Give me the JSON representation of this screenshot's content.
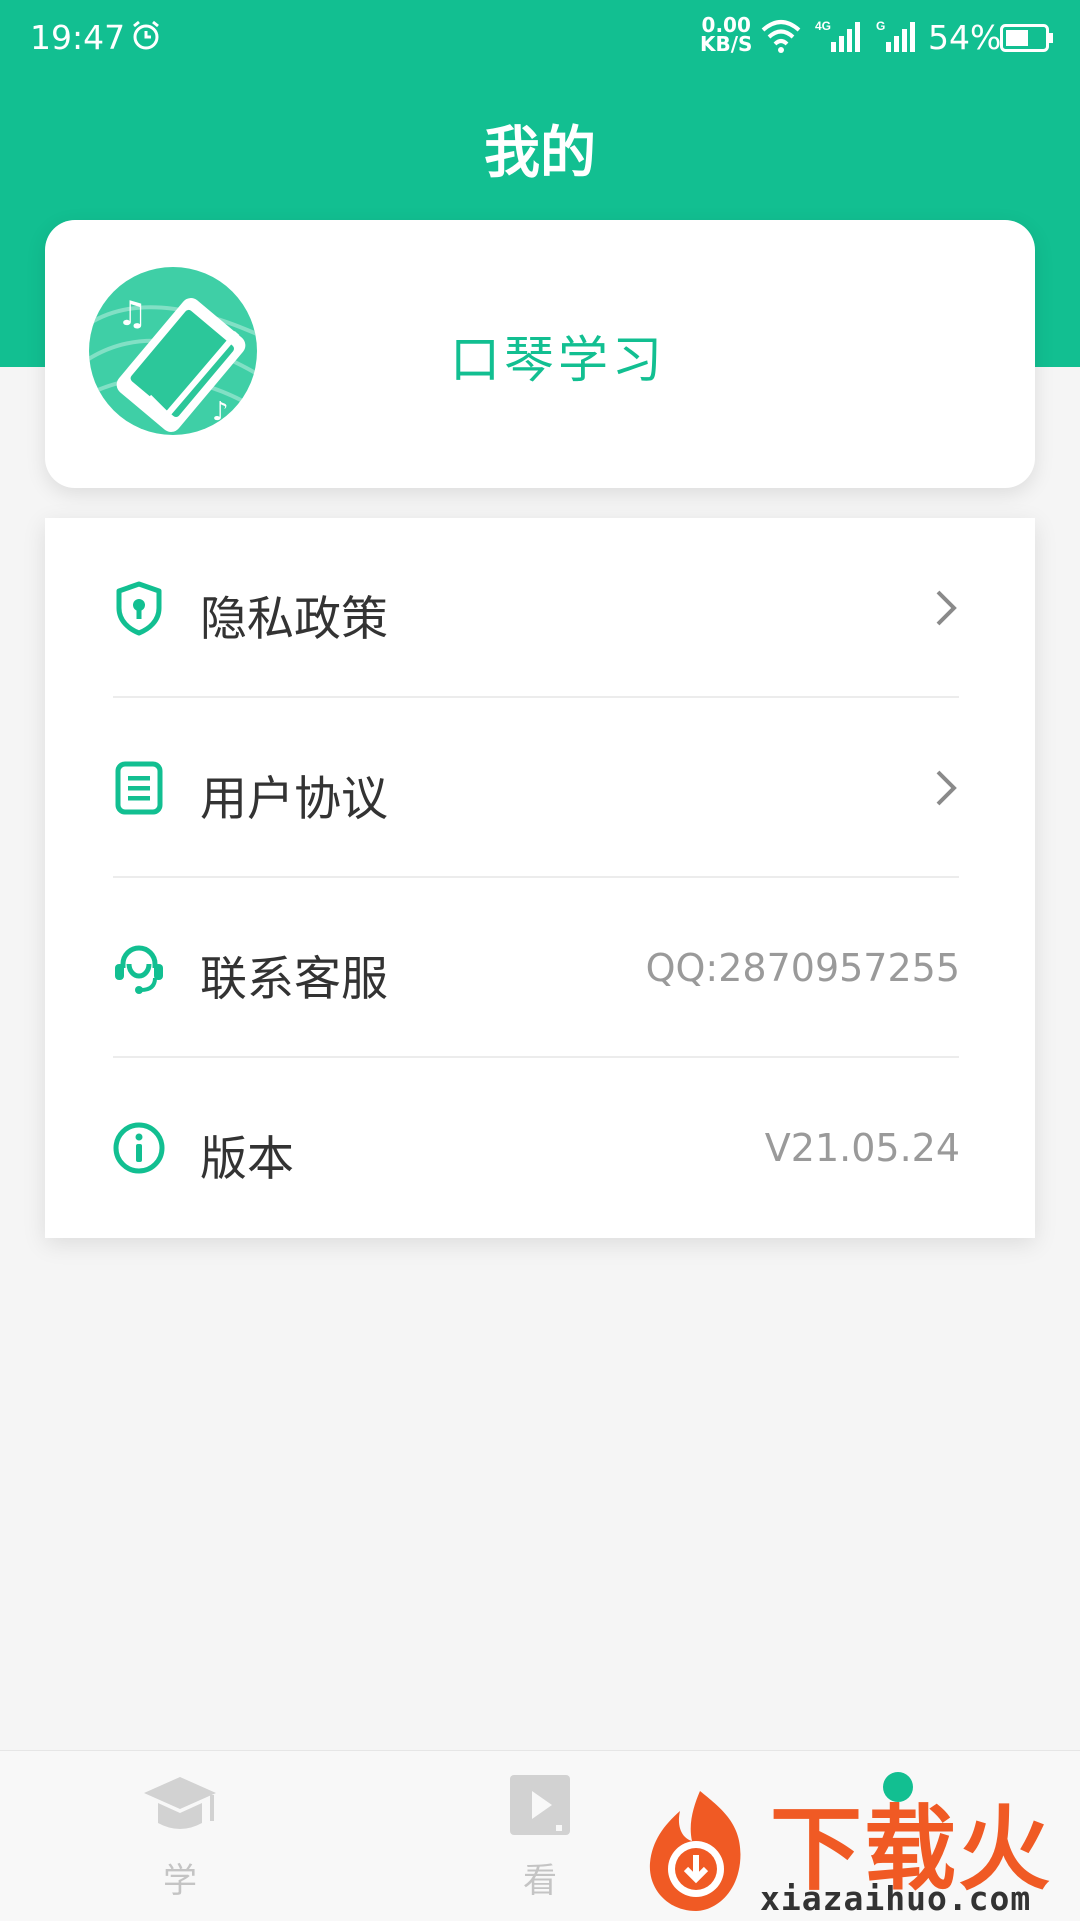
{
  "status_bar": {
    "time": "19:47",
    "net_speed_value": "0.00",
    "net_speed_unit": "KB/S",
    "signal1_label": "4G",
    "signal2_label": "G",
    "battery": "54%"
  },
  "header": {
    "title": "我的"
  },
  "profile": {
    "app_name": "口琴学习"
  },
  "menu": {
    "items": [
      {
        "label": "隐私政策",
        "icon": "shield-lock-icon",
        "chevron": true
      },
      {
        "label": "用户协议",
        "icon": "document-icon",
        "chevron": true
      },
      {
        "label": "联系客服",
        "icon": "headset-icon",
        "value": "QQ:2870957255"
      },
      {
        "label": "版本",
        "icon": "info-icon",
        "value": "V21.05.24"
      }
    ]
  },
  "bottom_nav": {
    "tabs": [
      {
        "label": "学",
        "icon": "graduation-cap-icon"
      },
      {
        "label": "看",
        "icon": "play-video-icon"
      }
    ]
  },
  "watermark": {
    "text_cn": "下载火",
    "text_en": "xiazaihuo.com"
  },
  "colors": {
    "accent": "#12bf91",
    "background": "#f5f5f5",
    "watermark": "#f05a24"
  }
}
